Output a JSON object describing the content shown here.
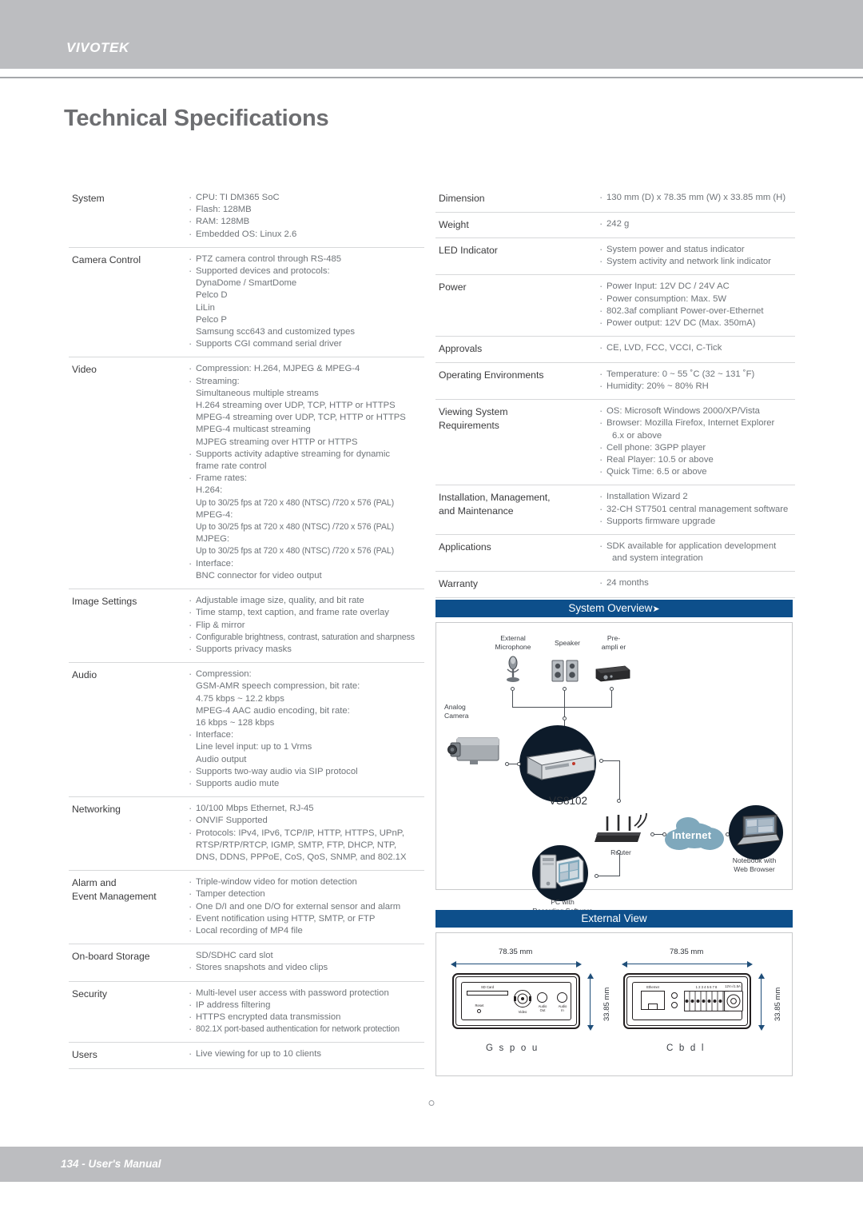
{
  "header": {
    "logo": "VIVOTEK"
  },
  "page": {
    "title": "Technical Specifications"
  },
  "footer": {
    "text": "134 - User's Manual"
  },
  "specs_left": [
    {
      "label": "System",
      "lines": [
        {
          "text": "CPU: TI DM365 SoC",
          "bullet": true
        },
        {
          "text": "Flash: 128MB",
          "bullet": true
        },
        {
          "text": "RAM: 128MB",
          "bullet": true
        },
        {
          "text": "Embedded OS: Linux 2.6",
          "bullet": true
        }
      ]
    },
    {
      "label": "Camera Control",
      "lines": [
        {
          "text": "PTZ camera control through RS-485",
          "bullet": true
        },
        {
          "text": "Supported devices and protocols:",
          "bullet": true
        },
        {
          "text": "DynaDome / SmartDome",
          "bullet": false
        },
        {
          "text": "Pelco D",
          "bullet": false
        },
        {
          "text": "LiLin",
          "bullet": false
        },
        {
          "text": "Pelco P",
          "bullet": false
        },
        {
          "text": "Samsung scc643 and customized types",
          "bullet": false
        },
        {
          "text": "Supports CGI command serial driver",
          "bullet": true
        }
      ]
    },
    {
      "label": "Video",
      "lines": [
        {
          "text": "Compression: H.264, MJPEG & MPEG-4",
          "bullet": true
        },
        {
          "text": "Streaming:",
          "bullet": true
        },
        {
          "text": "Simultaneous multiple streams",
          "bullet": false
        },
        {
          "text": "H.264 streaming over UDP, TCP, HTTP or HTTPS",
          "bullet": false
        },
        {
          "text": "MPEG-4 streaming over UDP, TCP, HTTP or HTTPS",
          "bullet": false
        },
        {
          "text": "MPEG-4 multicast streaming",
          "bullet": false
        },
        {
          "text": "MJPEG streaming over HTTP or HTTPS",
          "bullet": false
        },
        {
          "text": "Supports activity adaptive streaming for dynamic",
          "bullet": true
        },
        {
          "text": "frame rate control",
          "bullet": false
        },
        {
          "text": "Frame rates:",
          "bullet": true
        },
        {
          "text": "H.264:",
          "bullet": false
        },
        {
          "text": "Up to 30/25 fps at 720 x 480 (NTSC) /720 x 576 (PAL)",
          "bullet": false,
          "tight": true
        },
        {
          "text": "MPEG-4:",
          "bullet": false
        },
        {
          "text": "Up to 30/25 fps at 720 x 480 (NTSC) /720 x 576 (PAL)",
          "bullet": false,
          "tight": true
        },
        {
          "text": "MJPEG:",
          "bullet": false
        },
        {
          "text": "Up to 30/25 fps at 720 x 480 (NTSC) /720 x 576 (PAL)",
          "bullet": false,
          "tight": true
        },
        {
          "text": "Interface:",
          "bullet": true
        },
        {
          "text": "BNC connector for video output",
          "bullet": false
        }
      ]
    },
    {
      "label": "Image Settings",
      "lines": [
        {
          "text": "Adjustable image size, quality, and bit rate",
          "bullet": true
        },
        {
          "text": "Time stamp, text caption, and frame rate overlay",
          "bullet": true
        },
        {
          "text": "Flip & mirror",
          "bullet": true
        },
        {
          "text": "Configurable brightness, contrast, saturation and sharpness",
          "bullet": true,
          "tight": true
        },
        {
          "text": "Supports privacy masks",
          "bullet": true
        }
      ]
    },
    {
      "label": "Audio",
      "lines": [
        {
          "text": "Compression:",
          "bullet": true
        },
        {
          "text": "GSM-AMR speech compression, bit rate:",
          "bullet": false
        },
        {
          "text": "4.75 kbps ~ 12.2 kbps",
          "bullet": false
        },
        {
          "text": "MPEG-4 AAC audio encoding, bit rate:",
          "bullet": false
        },
        {
          "text": "16 kbps ~ 128 kbps",
          "bullet": false
        },
        {
          "text": "Interface:",
          "bullet": true
        },
        {
          "text": "Line level input: up to 1 Vrms",
          "bullet": false
        },
        {
          "text": "Audio output",
          "bullet": false
        },
        {
          "text": "Supports two-way audio via SIP protocol",
          "bullet": true
        },
        {
          "text": "Supports audio mute",
          "bullet": true
        }
      ]
    },
    {
      "label": "Networking",
      "lines": [
        {
          "text": "10/100 Mbps Ethernet, RJ-45",
          "bullet": true
        },
        {
          "text": "ONVIF Supported",
          "bullet": true
        },
        {
          "text": "Protocols: IPv4, IPv6, TCP/IP, HTTP, HTTPS, UPnP,",
          "bullet": true
        },
        {
          "text": "RTSP/RTP/RTCP, IGMP, SMTP, FTP, DHCP, NTP,",
          "bullet": false
        },
        {
          "text": "DNS, DDNS, PPPoE, CoS, QoS, SNMP, and 802.1X",
          "bullet": false
        }
      ]
    },
    {
      "label": "Alarm and\nEvent Management",
      "lines": [
        {
          "text": "Triple-window video for motion detection",
          "bullet": true
        },
        {
          "text": "Tamper detection",
          "bullet": true
        },
        {
          "text": "One D/I and one D/O for external sensor and alarm",
          "bullet": true
        },
        {
          "text": "Event notification using HTTP, SMTP, or FTP",
          "bullet": true
        },
        {
          "text": "Local recording of MP4 file",
          "bullet": true
        }
      ]
    },
    {
      "label": "On-board Storage",
      "lines": [
        {
          "text": "SD/SDHC card slot",
          "bullet": false
        },
        {
          "text": "Stores snapshots and video clips",
          "bullet": true
        }
      ]
    },
    {
      "label": "Security",
      "lines": [
        {
          "text": "Multi-level user access with password protection",
          "bullet": true
        },
        {
          "text": "IP address filtering",
          "bullet": true
        },
        {
          "text": "HTTPS encrypted data transmission",
          "bullet": true
        },
        {
          "text": "802.1X port-based authentication for network protection",
          "bullet": true,
          "tight": true
        }
      ]
    },
    {
      "label": "Users",
      "lines": [
        {
          "text": "Live viewing for up to 10 clients",
          "bullet": true
        }
      ]
    }
  ],
  "specs_right": [
    {
      "label": "Dimension",
      "lines": [
        {
          "text": "130 mm (D) x 78.35 mm (W) x 33.85 mm (H)",
          "bullet": true
        }
      ]
    },
    {
      "label": "Weight",
      "lines": [
        {
          "text": "242 g",
          "bullet": true
        }
      ]
    },
    {
      "label": "LED Indicator",
      "lines": [
        {
          "text": "System power and status indicator",
          "bullet": true
        },
        {
          "text": "System activity and network link indicator",
          "bullet": true
        }
      ]
    },
    {
      "label": "Power",
      "lines": [
        {
          "text": "Power Input: 12V DC / 24V AC",
          "bullet": true
        },
        {
          "text": "Power consumption: Max. 5W",
          "bullet": true
        },
        {
          "text": "802.3af compliant Power-over-Ethernet",
          "bullet": true
        },
        {
          "text": "Power output: 12V DC (Max. 350mA)",
          "bullet": true
        }
      ]
    },
    {
      "label": "Approvals",
      "lines": [
        {
          "text": "CE, LVD, FCC, VCCI, C-Tick",
          "bullet": true
        }
      ]
    },
    {
      "label": "Operating Environments",
      "lines": [
        {
          "text": "Temperature: 0 ~ 55 ˚C (32 ~ 131 ˚F)",
          "bullet": true
        },
        {
          "text": "Humidity: 20% ~ 80% RH",
          "bullet": true
        }
      ]
    },
    {
      "label": "Viewing System\nRequirements",
      "lines": [
        {
          "text": "OS: Microsoft Windows 2000/XP/Vista",
          "bullet": true
        },
        {
          "text": "Browser: Mozilla Firefox, Internet Explorer",
          "bullet": true
        },
        {
          "text": "6.x or above",
          "bullet": false,
          "indent": true
        },
        {
          "text": "Cell phone: 3GPP player",
          "bullet": true
        },
        {
          "text": "Real Player: 10.5 or above",
          "bullet": true
        },
        {
          "text": "Quick Time: 6.5 or above",
          "bullet": true
        }
      ]
    },
    {
      "label": "Installation, Management,\nand Maintenance",
      "lines": [
        {
          "text": "Installation Wizard 2",
          "bullet": true
        },
        {
          "text": "32-CH ST7501 central management software",
          "bullet": true
        },
        {
          "text": "Supports firmware upgrade",
          "bullet": true
        }
      ]
    },
    {
      "label": "Applications",
      "lines": [
        {
          "text": "SDK available for application development",
          "bullet": true
        },
        {
          "text": "and system integration",
          "bullet": false,
          "indent": true
        }
      ]
    },
    {
      "label": "Warranty",
      "lines": [
        {
          "text": "24 months",
          "bullet": true
        }
      ]
    }
  ],
  "system_overview": {
    "header": "System Overview",
    "header_arrow": "➤",
    "labels": {
      "external_microphone": "External\nMicrophone",
      "speaker": "Speaker",
      "preamplifier": "Pre-\nampli er",
      "analog_camera": "Analog\nCamera",
      "device": "VS8102",
      "router": "Router",
      "internet": "Internet",
      "notebook": "Notebook with\nWeb Browser",
      "pc": "PC with\nRecording Software"
    }
  },
  "external_view": {
    "header": "External View",
    "front": {
      "caption": "G s p o u",
      "width": "78.35 mm",
      "height": "33.85 mm",
      "ports": {
        "sd_card": "SD Card",
        "reset": "Reset",
        "video": "Video",
        "audio_out": "Audio\nOut",
        "audio_in": "Audio\nIn"
      }
    },
    "back": {
      "caption": "C b d l",
      "width": "78.35 mm",
      "height": "33.85 mm",
      "ports": {
        "ethernet": "Ethernet",
        "terminal": "1 2 3 4 5 6 7 8",
        "power": "12V=/1.5A"
      }
    }
  },
  "colors": {
    "banner": "#bcbdc0",
    "section_header": "#0d4f8b",
    "cloud": "#7fa8bc",
    "title": "#6d6e71"
  }
}
